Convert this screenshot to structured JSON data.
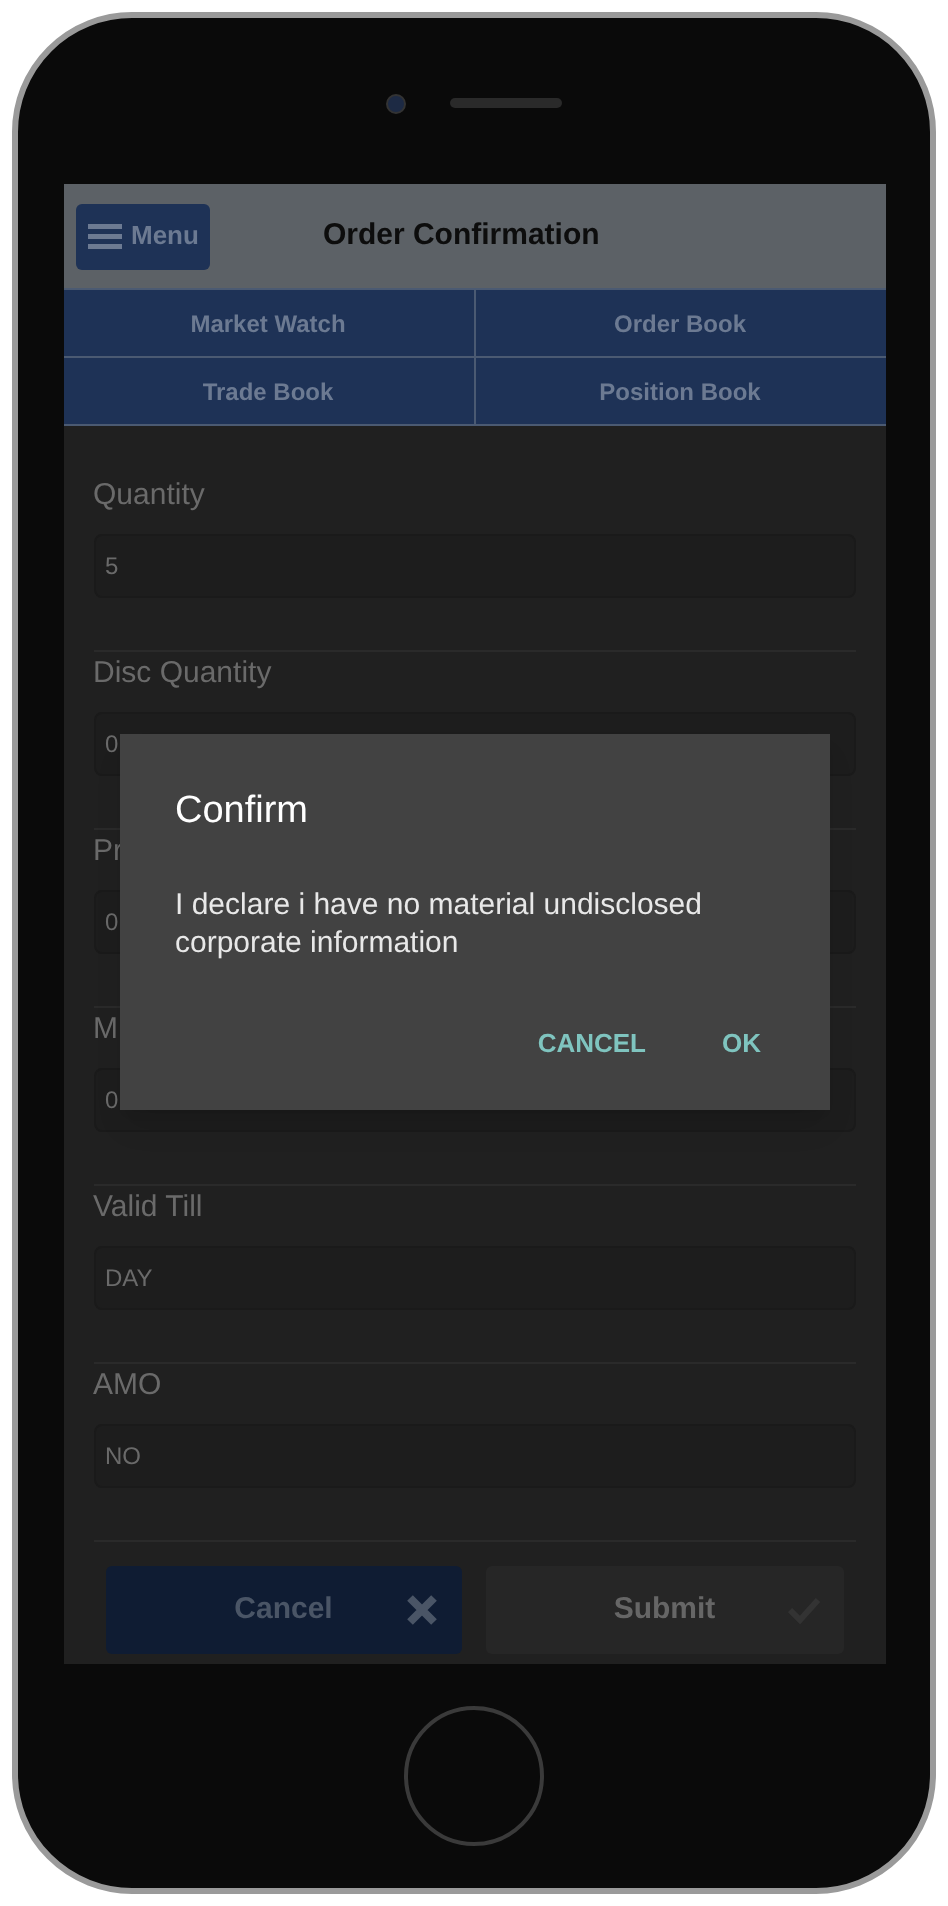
{
  "header": {
    "menu_button": "Menu",
    "title": "Order Confirmation"
  },
  "nav_tabs": [
    "Market Watch",
    "Order Book",
    "Trade Book",
    "Position Book"
  ],
  "fields": [
    {
      "label": "Quantity",
      "value": "5"
    },
    {
      "label": "Disc Quantity",
      "value": "0"
    },
    {
      "label": "Pr",
      "value": "0"
    },
    {
      "label": "M",
      "value": "0"
    },
    {
      "label": "Valid Till",
      "value": "DAY"
    },
    {
      "label": "AMO",
      "value": "NO"
    }
  ],
  "actions": [
    {
      "kind": "cancel",
      "label": "Cancel"
    },
    {
      "kind": "submit",
      "label": "Submit"
    }
  ],
  "dialog": {
    "title": "Confirm",
    "message": "I declare i have no material undisclosed corporate information",
    "buttons": [
      "CANCEL",
      "OK"
    ]
  }
}
